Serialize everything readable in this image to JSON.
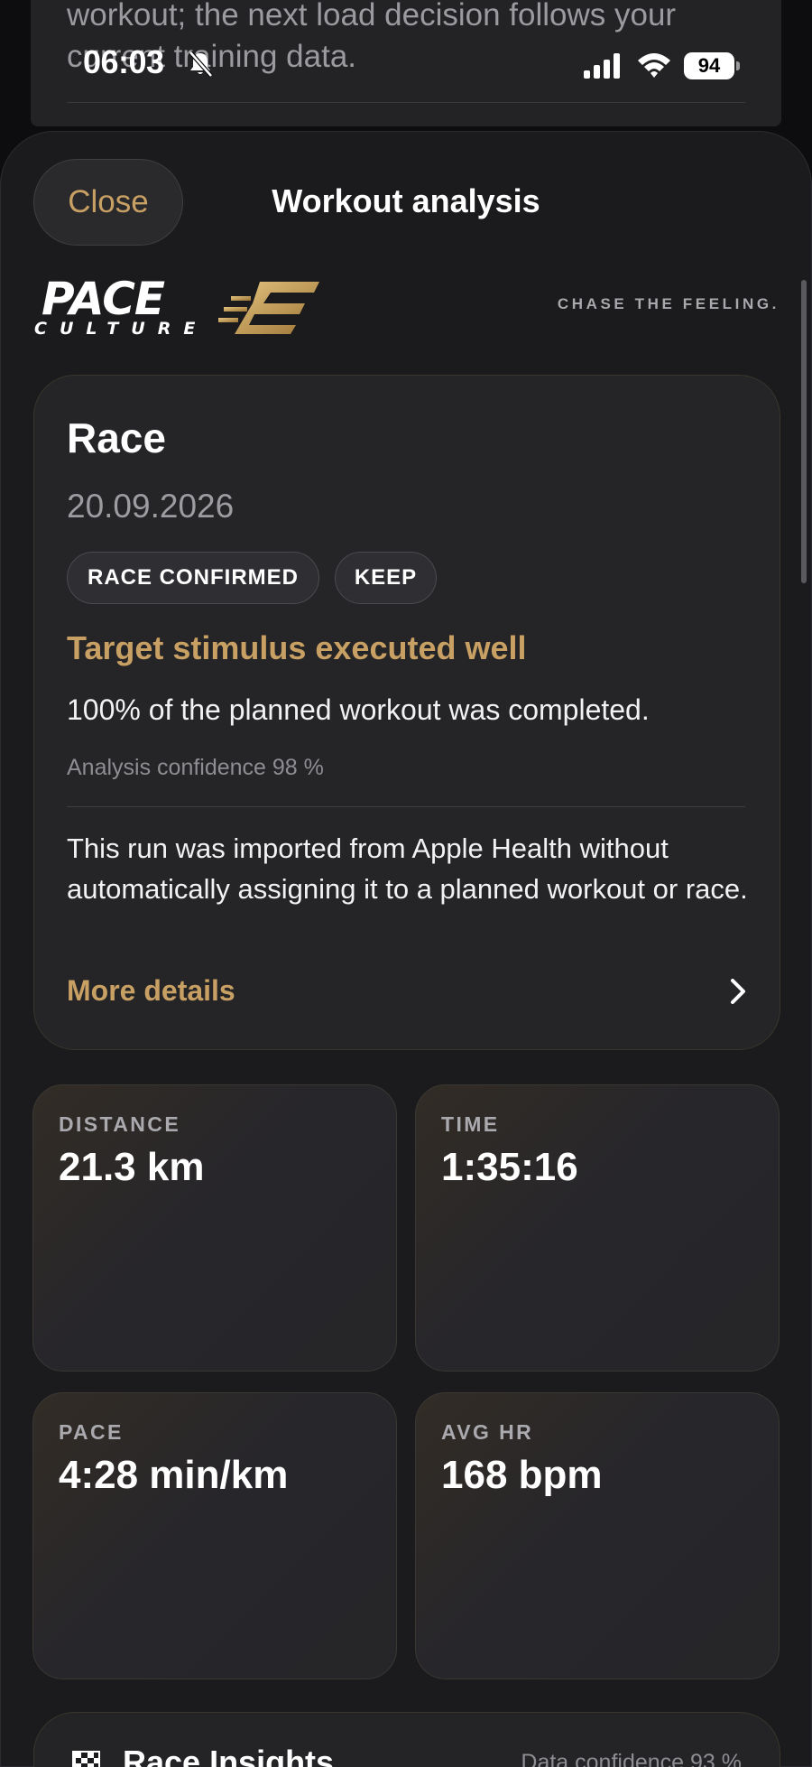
{
  "background": {
    "text": "workout; the next load decision follows your current training data."
  },
  "status_bar": {
    "time": "06:03",
    "battery": "94"
  },
  "sheet": {
    "close_label": "Close",
    "title": "Workout analysis"
  },
  "brand": {
    "logo_line1": "PACE",
    "logo_line2": "CULTURE",
    "tagline": "CHASE THE FEELING.",
    "accent_color": "#c9a063"
  },
  "race_card": {
    "title": "Race",
    "date": "20.09.2026",
    "badges": [
      "RACE CONFIRMED",
      "KEEP"
    ],
    "headline": "Target stimulus executed well",
    "summary": "100% of the planned workout was completed.",
    "confidence": "Analysis confidence 98 %",
    "note": "This run was imported from Apple Health without automatically assigning it to a planned workout or race.",
    "more_label": "More details"
  },
  "stats": [
    {
      "label": "DISTANCE",
      "value": "21.3 km"
    },
    {
      "label": "TIME",
      "value": "1:35:16"
    },
    {
      "label": "PACE",
      "value": "4:28 min/km"
    },
    {
      "label": "AVG HR",
      "value": "168 bpm"
    }
  ],
  "insights": {
    "title": "Race Insights",
    "confidence": "Data confidence 93 %"
  }
}
